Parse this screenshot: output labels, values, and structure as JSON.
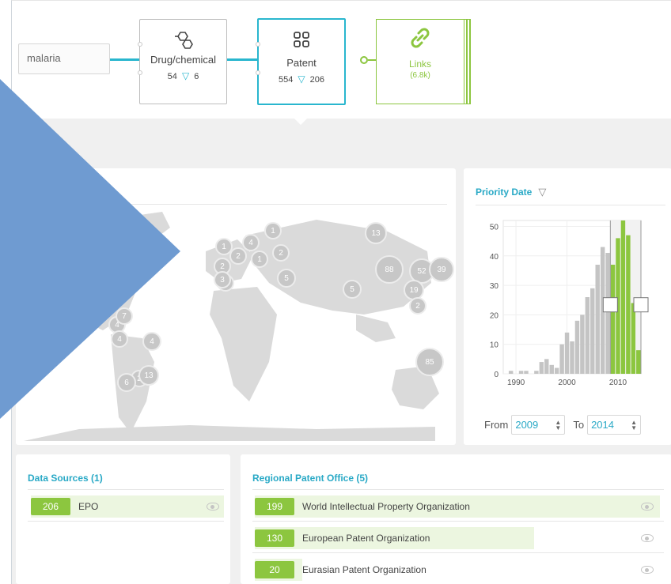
{
  "search": {
    "query": "malaria"
  },
  "nodes": {
    "drug": {
      "title": "Drug/chemical",
      "total": "54",
      "filtered": "6",
      "icon": "molecule-icon"
    },
    "patent": {
      "title": "Patent",
      "total": "554",
      "filtered": "206",
      "icon": "grid-icon"
    },
    "links": {
      "title": "Links",
      "count": "(6.8k)",
      "icon": "link-icon"
    }
  },
  "map": {
    "clusters": [
      "1",
      "4",
      "1",
      "2",
      "2",
      "1",
      "2",
      "2",
      "3",
      "5",
      "13",
      "88",
      "52",
      "39",
      "19",
      "2",
      "5",
      "4",
      "7",
      "4",
      "4",
      "2",
      "13",
      "6",
      "85"
    ]
  },
  "priority_date": {
    "title": "Priority Date",
    "from_label": "From",
    "to_label": "To",
    "from_value": "2009",
    "to_value": "2014"
  },
  "chart_data": {
    "type": "bar",
    "x": [
      1988,
      1989,
      1990,
      1991,
      1992,
      1993,
      1994,
      1995,
      1996,
      1997,
      1998,
      1999,
      2000,
      2001,
      2002,
      2003,
      2004,
      2005,
      2006,
      2007,
      2008,
      2009,
      2010,
      2011,
      2012,
      2013,
      2014
    ],
    "values": [
      0,
      1,
      0,
      1,
      1,
      0,
      1,
      4,
      5,
      3,
      2,
      10,
      14,
      11,
      18,
      20,
      26,
      29,
      37,
      43,
      41,
      37,
      46,
      52,
      47,
      24,
      8
    ],
    "selected_range": [
      2009,
      2014
    ],
    "xlabel": "",
    "ylabel": "",
    "x_ticks": [
      "1990",
      "2000",
      "2010"
    ],
    "y_ticks": [
      "0",
      "10",
      "20",
      "30",
      "40",
      "50"
    ],
    "ylim": [
      0,
      52
    ],
    "colors": {
      "selected": "#8cc63f",
      "unselected": "#c4c4c4"
    }
  },
  "data_sources": {
    "title": "Data Sources (1)",
    "items": [
      {
        "count": "206",
        "label": "EPO",
        "fraction": 1.0
      }
    ]
  },
  "patent_offices": {
    "title": "Regional Patent Office (5)",
    "items": [
      {
        "count": "199",
        "label": "World Intellectual Property Organization",
        "fraction": 1.0
      },
      {
        "count": "130",
        "label": "European Patent Organization",
        "fraction": 0.65
      },
      {
        "count": "20",
        "label": "Eurasian Patent Organization",
        "fraction": 0.1
      }
    ]
  },
  "colors": {
    "accent": "#29b6ce",
    "green": "#8cc63f",
    "overlay": "#6f9bd1"
  }
}
